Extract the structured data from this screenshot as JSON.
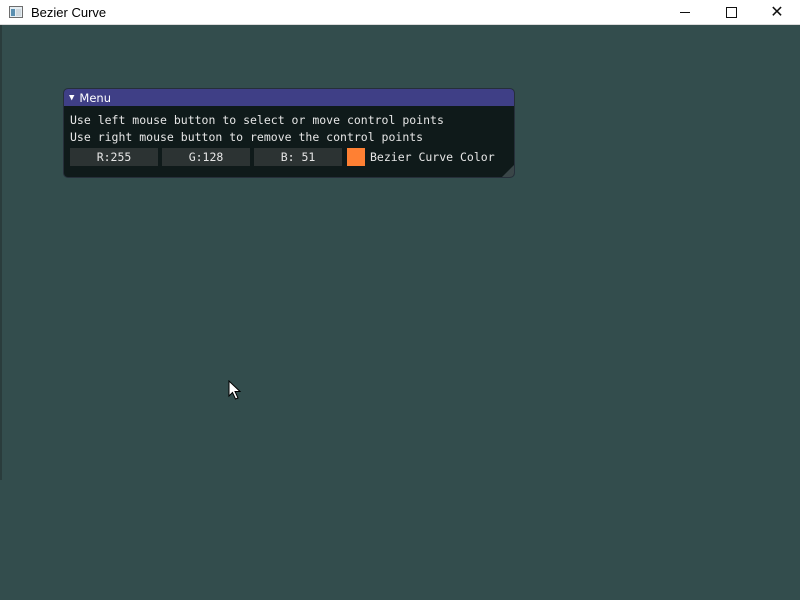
{
  "window": {
    "title": "Bezier Curve",
    "close_glyph": "✕"
  },
  "panel": {
    "title": "Menu",
    "collapse_glyph": "▼",
    "instructions": [
      "Use left mouse button to select or move control points",
      "Use right mouse button to remove the control points"
    ],
    "color_fields": {
      "r": "R:255",
      "g": "G:128",
      "b": "B: 51"
    },
    "swatch_label": "Bezier Curve Color",
    "swatch_color": "#ff8033"
  },
  "colors": {
    "background": "#334d4d",
    "panel_header": "#3f3f86",
    "panel_body": "#0f1a1a"
  },
  "icons": [
    "app-icon",
    "minimize-icon",
    "maximize-icon",
    "close-icon",
    "collapse-arrow-icon",
    "resize-grip-icon",
    "mouse-cursor-icon"
  ]
}
